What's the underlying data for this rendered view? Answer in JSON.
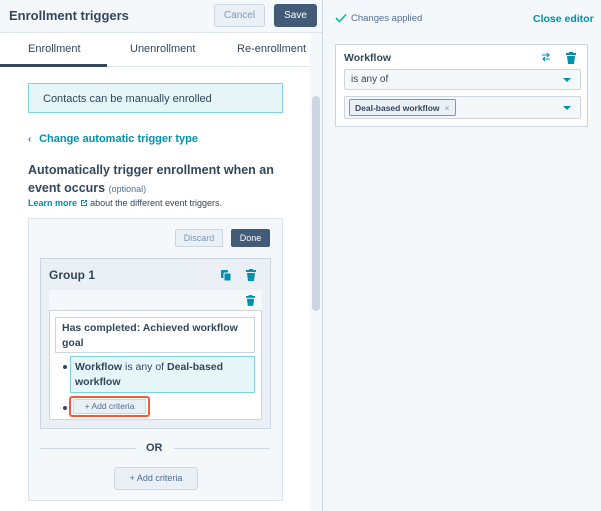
{
  "header": {
    "title": "Enrollment triggers",
    "cancel_label": "Cancel",
    "save_label": "Save"
  },
  "tabs": [
    {
      "label": "Enrollment",
      "active": true
    },
    {
      "label": "Unenrollment",
      "active": false
    },
    {
      "label": "Re-enrollment",
      "active": false
    }
  ],
  "info_box": "Contacts can be manually enrolled",
  "change_trigger_link": "Change automatic trigger type",
  "section": {
    "heading": "Automatically trigger enrollment when an event occurs",
    "optional": "(optional)",
    "learn_more_link": "Learn more",
    "learn_more_text": "about the different event triggers."
  },
  "card": {
    "discard_label": "Discard",
    "done_label": "Done",
    "group_title": "Group 1",
    "condition_1": "Has completed: Achieved workflow goal",
    "condition_2": {
      "field": "Workflow",
      "operator": "is any of",
      "value": "Deal-based workflow"
    },
    "add_criteria_label": "Add criteria",
    "or_label": "OR",
    "add_criteria_label_2": "Add criteria"
  },
  "right_panel": {
    "status": "Changes applied",
    "close_editor": "Close editor",
    "filter_title": "Workflow",
    "operator_value": "is any of",
    "selected_chip": "Deal-based workflow"
  },
  "colors": {
    "accent": "#0091ae",
    "primary_button": "#425b76",
    "highlight": "#ee5e3b",
    "success": "#00bda5"
  }
}
